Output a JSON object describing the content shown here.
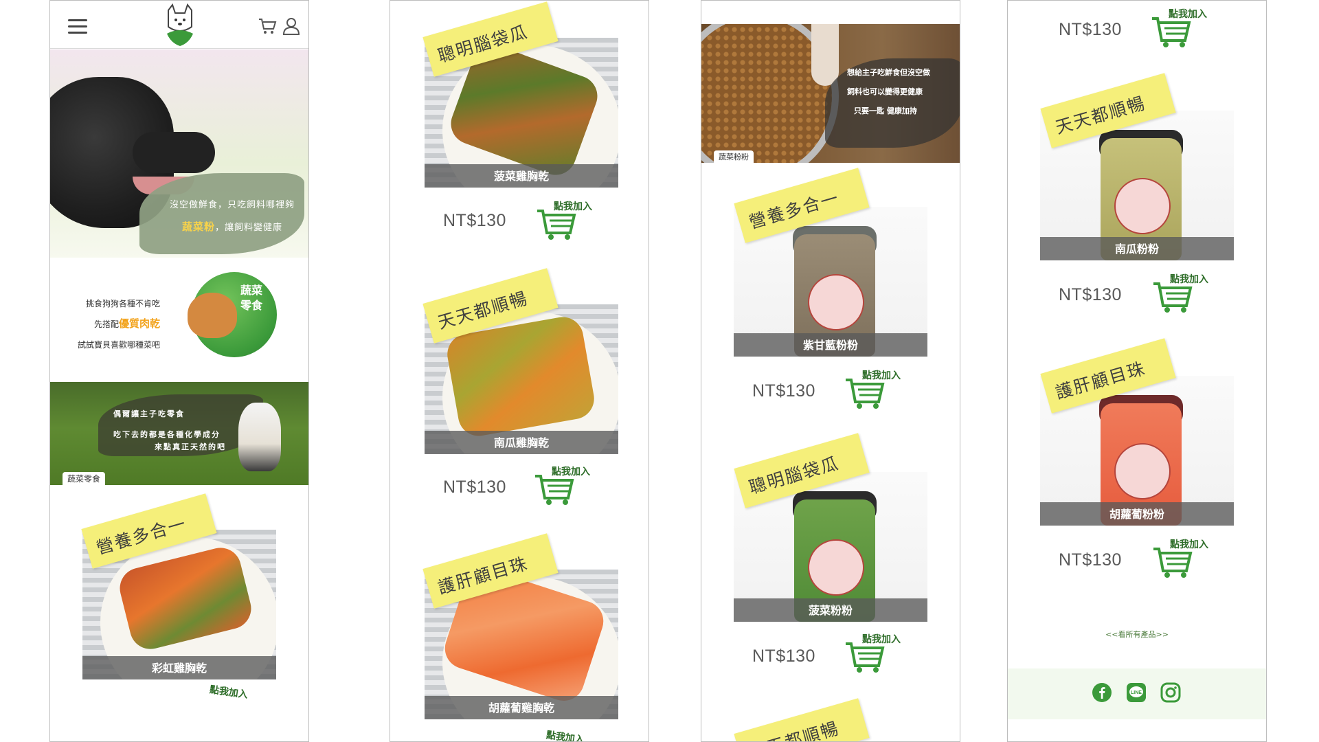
{
  "panel1": {
    "hero_line1": "沒空做鮮食，只吃飼料哪裡夠",
    "hero_highlight": "蔬菜粉",
    "hero_line2": "，讓飼料變健康",
    "intro_line1": "挑食狗狗各種不肯吃",
    "intro_line2_pre": "先搭配",
    "intro_line2_highlight": "優質肉乾",
    "intro_line3": "試試寶貝喜歡哪種菜吧",
    "badge_line1": "蔬菜",
    "badge_line2": "零食",
    "grass_line1": "偶爾讓主子吃零食",
    "grass_line2": "吃下去的都是各種化學成分",
    "grass_line3": "來點真正天然的吧",
    "grass_tag": "蔬菜零食",
    "product1_note": "營養多合一",
    "product1_name": "彩虹雞胸乾",
    "cart_label": "點我加入"
  },
  "panel2": {
    "products": [
      {
        "note": "聰明腦袋瓜",
        "name": "菠菜雞胸乾",
        "price": "NT$130"
      },
      {
        "note": "天天都順暢",
        "name": "南瓜雞胸乾",
        "price": "NT$130"
      },
      {
        "note": "護肝顧目珠",
        "name": "胡蘿蔔雞胸乾"
      }
    ]
  },
  "panel3": {
    "banner_line1": "想給主子吃鮮食但沒空做",
    "banner_line2": "飼料也可以變得更健康",
    "banner_line3": "只要一匙 健康加持",
    "banner_tag": "蔬菜粉粉",
    "products": [
      {
        "note": "營養多合一",
        "name": "紫甘藍粉粉",
        "price": "NT$130"
      },
      {
        "note": "聰明腦袋瓜",
        "name": "菠菜粉粉",
        "price": "NT$130"
      },
      {
        "note": "天天都順暢"
      }
    ]
  },
  "panel4": {
    "top_price": "NT$130",
    "products": [
      {
        "note": "天天都順暢",
        "name": "南瓜粉粉",
        "price": "NT$130"
      },
      {
        "note": "護肝顧目珠",
        "name": "胡蘿蔔粉粉",
        "price": "NT$130"
      }
    ],
    "see_all": "<<看所有產品>>"
  },
  "colors": {
    "accent_green": "#3b9a3a",
    "note_yellow": "#f5ef7a",
    "highlight_orange": "#f2a21a"
  },
  "icons": [
    "menu-icon",
    "cart-icon",
    "user-icon",
    "facebook-icon",
    "line-icon",
    "instagram-icon"
  ]
}
